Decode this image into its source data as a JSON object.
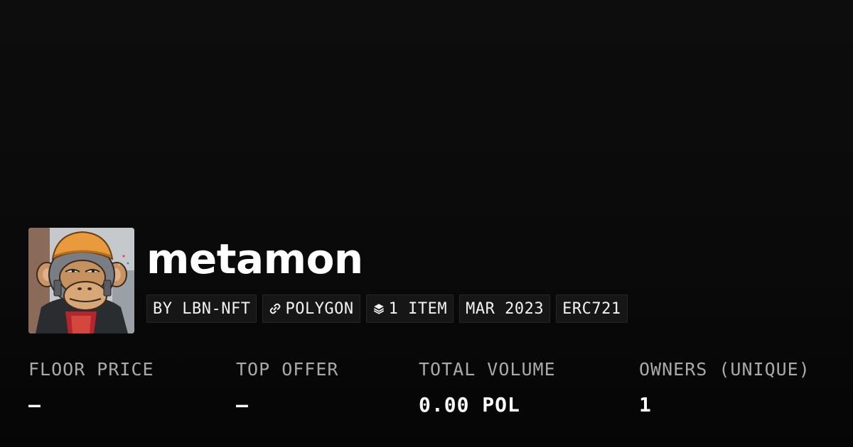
{
  "collection": {
    "name": "metamon",
    "avatar_alt": "ape-avatar"
  },
  "badges": {
    "creator": "BY LBN-NFT",
    "chain": "POLYGON",
    "chain_icon": "link-icon",
    "items": "1 ITEM",
    "items_icon": "layers-icon",
    "date": "MAR 2023",
    "standard": "ERC721"
  },
  "stats": {
    "floor_price": {
      "label": "FLOOR PRICE",
      "value": "–"
    },
    "top_offer": {
      "label": "TOP OFFER",
      "value": "–"
    },
    "total_volume": {
      "label": "TOTAL VOLUME",
      "value": "0.00 POL"
    },
    "owners": {
      "label": "OWNERS (UNIQUE)",
      "value": "1"
    }
  },
  "colors": {
    "background": "#0a0a0a",
    "badge_bg": "#161616",
    "label_gray": "#a9a9a9",
    "text": "#ffffff"
  }
}
